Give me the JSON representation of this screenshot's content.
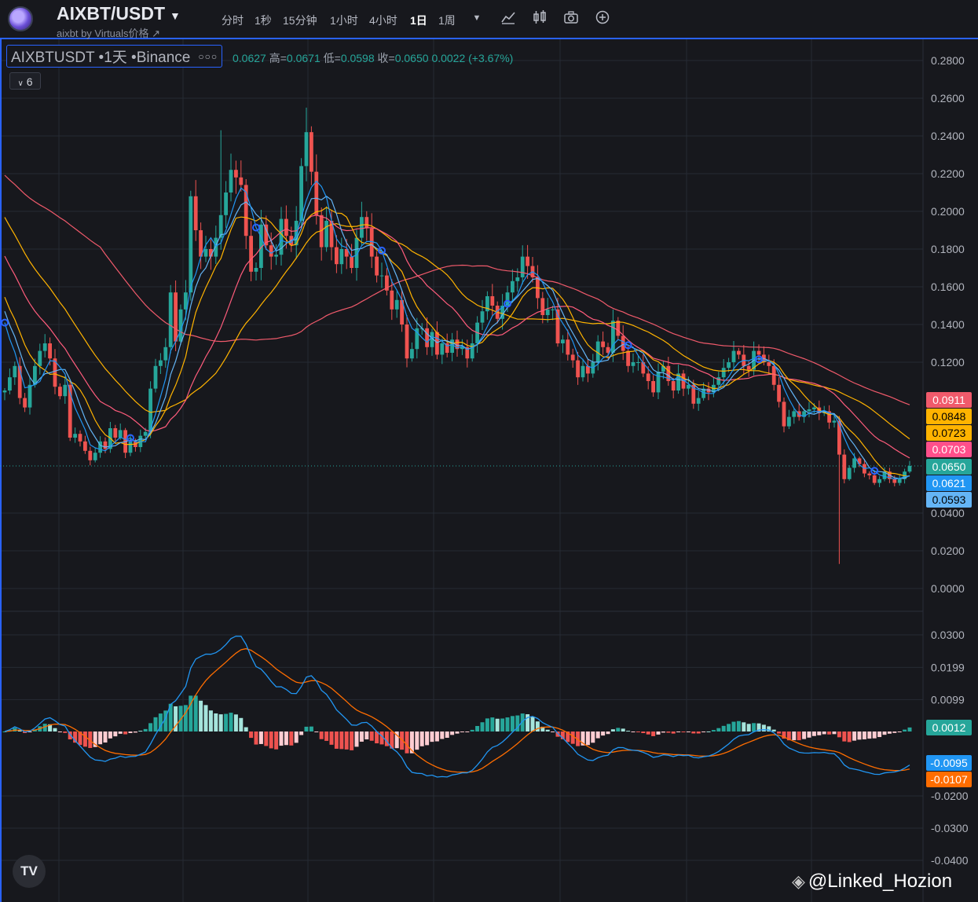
{
  "header": {
    "symbol": "AIXBT/USDT",
    "subtitle": "aixbt by Virtuals价格 ↗",
    "timeframes": [
      "分时",
      "1秒",
      "15分钟",
      "1小时",
      "4小时",
      "1日",
      "1周"
    ],
    "active_timeframe": "1日"
  },
  "legend": {
    "title": "AIXBTUSDT •1天 •Binance",
    "open_value": "0.0627",
    "high_label": "高=",
    "high_value": "0.0671",
    "low_label": "低=",
    "low_value": "0.0598",
    "close_label": "收=",
    "close_value": "0.0650",
    "change": "0.0022 (+3.67%)",
    "indicator_count": "6"
  },
  "colors": {
    "up": "#26a69a",
    "down": "#ef5350",
    "ma_blue": "#2196f3",
    "ma_light_blue": "#64b5f6",
    "ma_yellow": "#ffb300",
    "ma_pink": "#ff5c7c",
    "ma_red": "#f05a6b",
    "macd_line": "#2196f3",
    "signal_line": "#ff6d00"
  },
  "badges": {
    "b1": {
      "text": "0.0911",
      "color": "#f05a6b"
    },
    "b2": {
      "text": "0.0848",
      "color": "#ffb300"
    },
    "b3": {
      "text": "0.0723",
      "color": "#ffb300"
    },
    "b4": {
      "text": "0.0703",
      "color": "#ff4f8b"
    },
    "b5": {
      "text": "0.0650",
      "color": "#26a69a"
    },
    "b6": {
      "text": "0.0621",
      "color": "#2196f3"
    },
    "b7": {
      "text": "0.0593",
      "color": "#64b5f6"
    },
    "m1": {
      "text": "0.0012",
      "color": "#26a69a"
    },
    "m2": {
      "text": "-0.0095",
      "color": "#2196f3"
    },
    "m3": {
      "text": "-0.0107",
      "color": "#ff6d00"
    }
  },
  "watermark": "@Linked_Hozion",
  "tv_logo": "TV",
  "chart_data": [
    {
      "type": "candlestick",
      "title": "AIXBTUSDT",
      "yticks": [
        "0.2800",
        "0.2600",
        "0.2400",
        "0.2200",
        "0.2000",
        "0.1800",
        "0.1600",
        "0.1400",
        "0.1200",
        "0.0400",
        "0.0200",
        "0.0000"
      ],
      "ylim": [
        0,
        0.29
      ],
      "grid": true,
      "last_close": 0.065,
      "closes": [
        0.105,
        0.112,
        0.118,
        0.101,
        0.096,
        0.108,
        0.118,
        0.126,
        0.13,
        0.122,
        0.107,
        0.102,
        0.108,
        0.08,
        0.082,
        0.078,
        0.073,
        0.068,
        0.072,
        0.078,
        0.074,
        0.085,
        0.08,
        0.084,
        0.072,
        0.078,
        0.075,
        0.081,
        0.083,
        0.106,
        0.118,
        0.121,
        0.128,
        0.157,
        0.131,
        0.148,
        0.157,
        0.208,
        0.19,
        0.176,
        0.18,
        0.176,
        0.186,
        0.198,
        0.21,
        0.222,
        0.218,
        0.214,
        0.187,
        0.168,
        0.17,
        0.193,
        0.182,
        0.176,
        0.177,
        0.196,
        0.187,
        0.182,
        0.195,
        0.224,
        0.242,
        0.221,
        0.198,
        0.181,
        0.195,
        0.181,
        0.172,
        0.18,
        0.176,
        0.17,
        0.186,
        0.197,
        0.191,
        0.176,
        0.166,
        0.166,
        0.158,
        0.148,
        0.153,
        0.14,
        0.122,
        0.127,
        0.138,
        0.138,
        0.128,
        0.136,
        0.124,
        0.13,
        0.125,
        0.132,
        0.127,
        0.128,
        0.122,
        0.13,
        0.141,
        0.147,
        0.155,
        0.15,
        0.143,
        0.15,
        0.157,
        0.163,
        0.165,
        0.176,
        0.171,
        0.165,
        0.154,
        0.145,
        0.148,
        0.148,
        0.13,
        0.132,
        0.124,
        0.121,
        0.112,
        0.118,
        0.114,
        0.12,
        0.131,
        0.128,
        0.125,
        0.142,
        0.134,
        0.126,
        0.118,
        0.12,
        0.12,
        0.114,
        0.11,
        0.104,
        0.115,
        0.118,
        0.11,
        0.105,
        0.114,
        0.106,
        0.108,
        0.098,
        0.101,
        0.106,
        0.104,
        0.108,
        0.112,
        0.117,
        0.12,
        0.126,
        0.124,
        0.118,
        0.116,
        0.126,
        0.124,
        0.12,
        0.118,
        0.108,
        0.099,
        0.086,
        0.091,
        0.094,
        0.091,
        0.094,
        0.095,
        0.096,
        0.093,
        0.094,
        0.088,
        0.089,
        0.071,
        0.058,
        0.064,
        0.069,
        0.066,
        0.061,
        0.06,
        0.056,
        0.058,
        0.062,
        0.058,
        0.056,
        0.058,
        0.062,
        0.065
      ]
    },
    {
      "type": "macd",
      "yticks": [
        "0.0300",
        "0.0199",
        "0.0099",
        "-0.0200",
        "-0.0300",
        "-0.0400"
      ],
      "ylim": [
        -0.045,
        0.034
      ],
      "grid": true,
      "macd_last": -0.0095,
      "signal_last": -0.0107,
      "histogram_last": 0.0012
    }
  ]
}
